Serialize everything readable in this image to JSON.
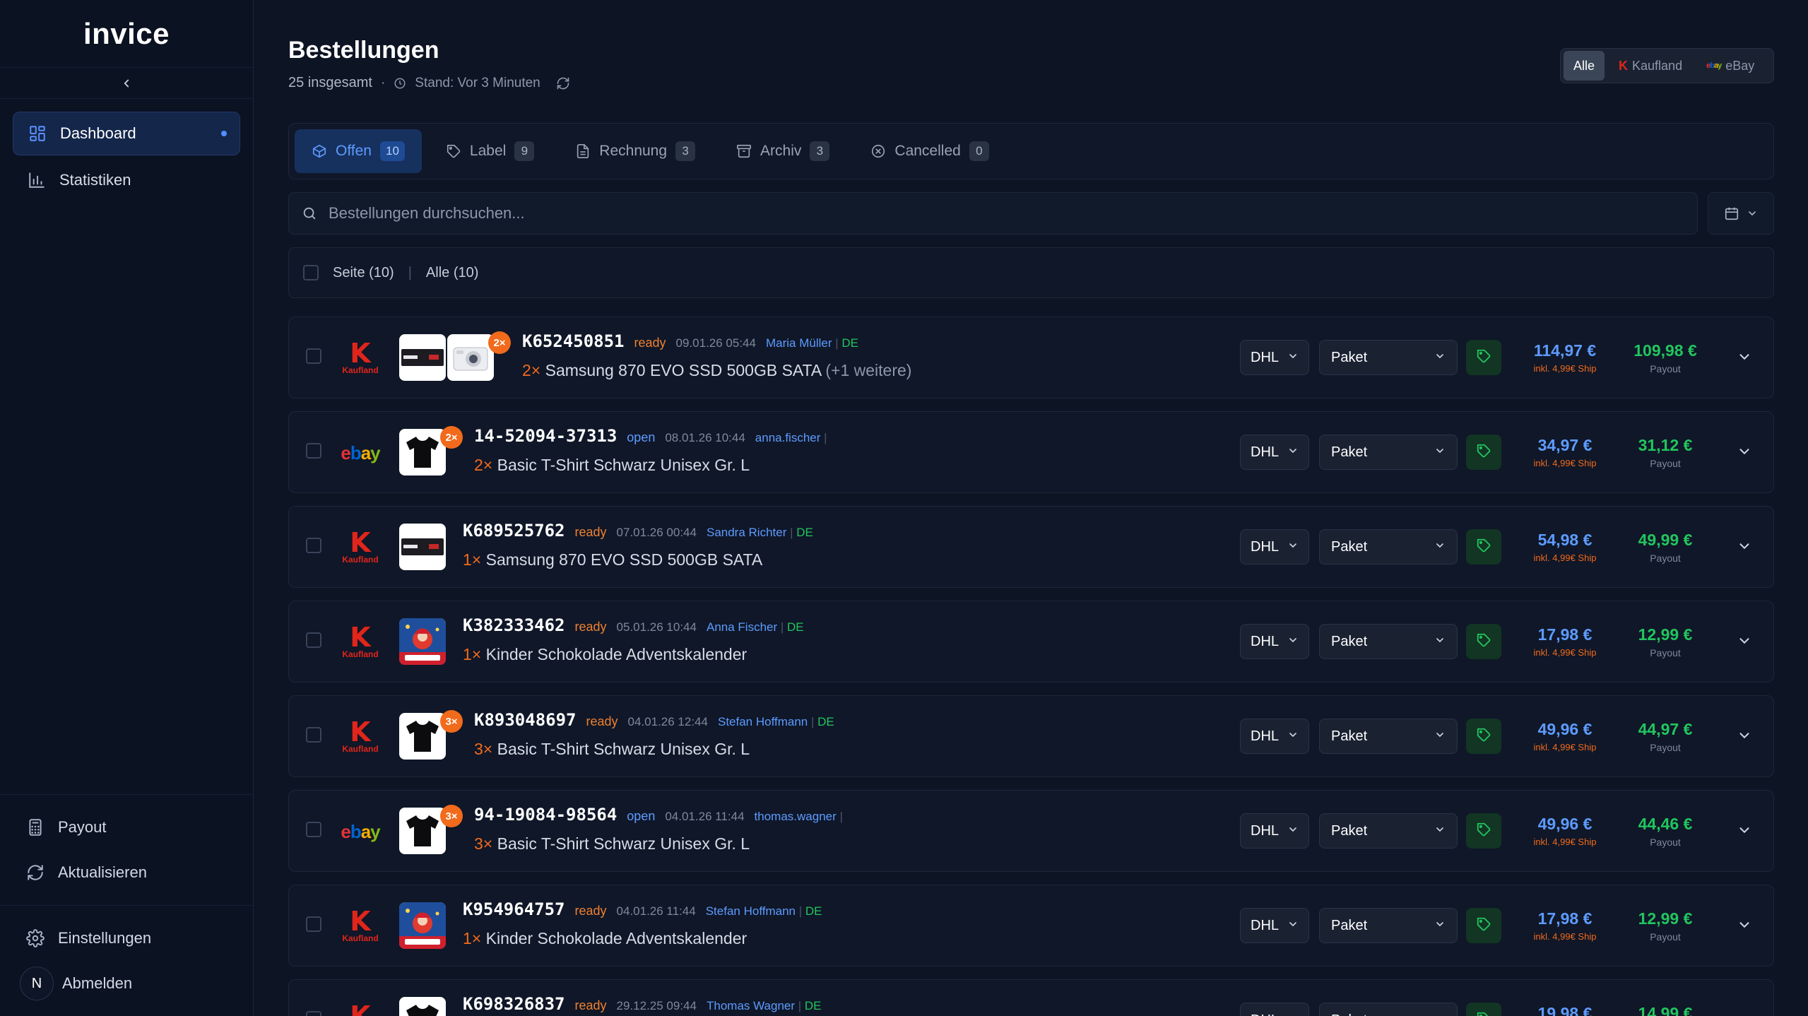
{
  "app": {
    "brand": "invice"
  },
  "sidebar": {
    "items": [
      {
        "label": "Dashboard"
      },
      {
        "label": "Statistiken"
      }
    ],
    "bottom": [
      {
        "label": "Payout"
      },
      {
        "label": "Aktualisieren"
      },
      {
        "label": "Einstellungen"
      },
      {
        "label": "Abmelden"
      }
    ],
    "avatar_letter": "N"
  },
  "header": {
    "title": "Bestellungen",
    "total": "25 insgesamt",
    "dot": "·",
    "stand": "Stand: Vor 3 Minuten"
  },
  "marketplace": {
    "all": "Alle",
    "kaufland": "Kaufland",
    "ebay": "eBay"
  },
  "tabs": [
    {
      "label": "Offen",
      "count": "10"
    },
    {
      "label": "Label",
      "count": "9"
    },
    {
      "label": "Rechnung",
      "count": "3"
    },
    {
      "label": "Archiv",
      "count": "3"
    },
    {
      "label": "Cancelled",
      "count": "0"
    }
  ],
  "search": {
    "placeholder": "Bestellungen durchsuchen..."
  },
  "selection": {
    "page": "Seite (10)",
    "divider": "|",
    "all": "Alle (10)"
  },
  "order_common": {
    "carrier": "DHL",
    "package": "Paket",
    "ship_note": "inkl. 4,99€ Ship",
    "payout_label": "Payout",
    "kaufland_text": "Kaufland",
    "kaufland_k": "K",
    "ebay_letters": [
      "e",
      "b",
      "a",
      "y"
    ]
  },
  "orders": [
    {
      "market": "kaufland",
      "number": "K652450851",
      "status": "ready",
      "date": "09.01.26 05:44",
      "customer": "Maria Müller",
      "country": "DE",
      "qty": "2×",
      "product": "Samsung 870 EVO SSD 500GB SATA",
      "more": "(+1 weitere)",
      "thumbs": [
        "ssd",
        "camera"
      ],
      "badge": "2×",
      "price": "114,97 €",
      "payout": "109,98 €"
    },
    {
      "market": "ebay",
      "number": "14-52094-37313",
      "status": "open",
      "date": "08.01.26 10:44",
      "customer": "anna.fischer",
      "country": "",
      "qty": "2×",
      "product": "Basic T-Shirt Schwarz Unisex Gr. L",
      "more": "",
      "thumbs": [
        "shirt"
      ],
      "badge": "2×",
      "price": "34,97 €",
      "payout": "31,12 €"
    },
    {
      "market": "kaufland",
      "number": "K689525762",
      "status": "ready",
      "date": "07.01.26 00:44",
      "customer": "Sandra Richter",
      "country": "DE",
      "qty": "1×",
      "product": "Samsung 870 EVO SSD 500GB SATA",
      "more": "",
      "thumbs": [
        "ssd"
      ],
      "badge": "",
      "price": "54,98 €",
      "payout": "49,99 €"
    },
    {
      "market": "kaufland",
      "number": "K382333462",
      "status": "ready",
      "date": "05.01.26 10:44",
      "customer": "Anna Fischer",
      "country": "DE",
      "qty": "1×",
      "product": "Kinder Schokolade Adventskalender",
      "more": "",
      "thumbs": [
        "calendar"
      ],
      "badge": "",
      "price": "17,98 €",
      "payout": "12,99 €"
    },
    {
      "market": "kaufland",
      "number": "K893048697",
      "status": "ready",
      "date": "04.01.26 12:44",
      "customer": "Stefan Hoffmann",
      "country": "DE",
      "qty": "3×",
      "product": "Basic T-Shirt Schwarz Unisex Gr. L",
      "more": "",
      "thumbs": [
        "shirt"
      ],
      "badge": "3×",
      "price": "49,96 €",
      "payout": "44,97 €"
    },
    {
      "market": "ebay",
      "number": "94-19084-98564",
      "status": "open",
      "date": "04.01.26 11:44",
      "customer": "thomas.wagner",
      "country": "",
      "qty": "3×",
      "product": "Basic T-Shirt Schwarz Unisex Gr. L",
      "more": "",
      "thumbs": [
        "shirt"
      ],
      "badge": "3×",
      "price": "49,96 €",
      "payout": "44,46 €"
    },
    {
      "market": "kaufland",
      "number": "K954964757",
      "status": "ready",
      "date": "04.01.26 11:44",
      "customer": "Stefan Hoffmann",
      "country": "DE",
      "qty": "1×",
      "product": "Kinder Schokolade Adventskalender",
      "more": "",
      "thumbs": [
        "calendar"
      ],
      "badge": "",
      "price": "17,98 €",
      "payout": "12,99 €"
    },
    {
      "market": "kaufland",
      "number": "K698326837",
      "status": "ready",
      "date": "29.12.25 09:44",
      "customer": "Thomas Wagner",
      "country": "DE",
      "qty": "",
      "product": "",
      "more": "",
      "thumbs": [
        "shirt"
      ],
      "badge": "",
      "price": "19,98 €",
      "payout": "14,99 €"
    }
  ],
  "colors": {
    "accent": "#5e9bff",
    "ready": "#f0802f",
    "open": "#5e9bff",
    "payout": "#22c55e",
    "kaufland": "#e1251b"
  }
}
